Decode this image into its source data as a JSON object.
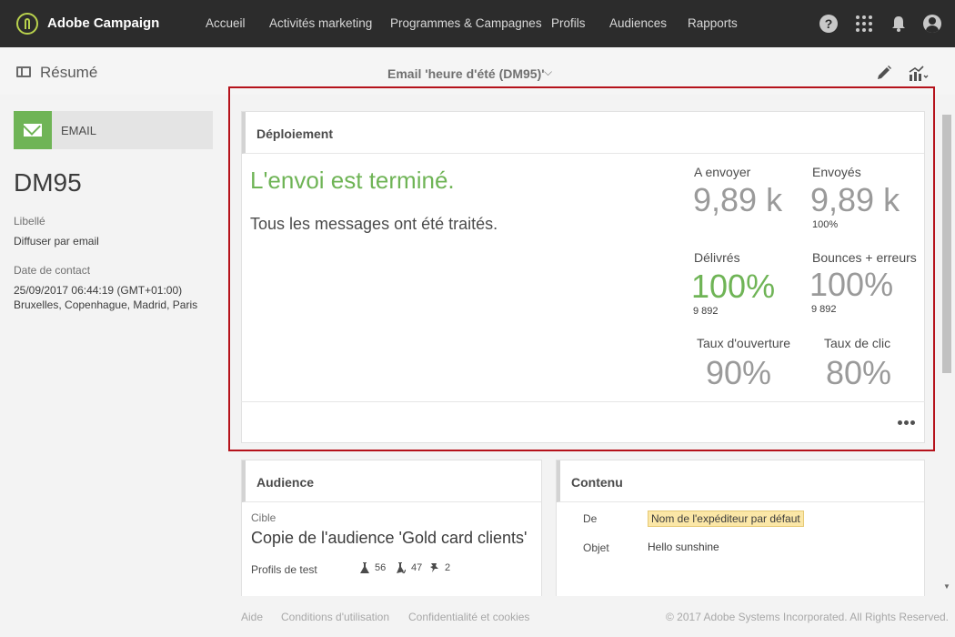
{
  "app": {
    "name": "Adobe Campaign"
  },
  "nav": {
    "items": [
      "Accueil",
      "Activités marketing",
      "Programmes & Campagnes",
      "Profils",
      "Audiences",
      "Rapports"
    ],
    "help": "?"
  },
  "subheader": {
    "title": "Résumé",
    "delivery_title": "Email 'heure d'été (DM95)'"
  },
  "left": {
    "channel": "EMAIL",
    "code": "DM95",
    "label_caption": "Libellé",
    "label_value": "Diffuser par email",
    "contact_caption": "Date de contact",
    "contact_date": "25/09/2017 06:44:19 (GMT+01:00)",
    "contact_tz": "Bruxelles, Copenhague, Madrid, Paris"
  },
  "deployment": {
    "title": "Déploiement",
    "status": "L'envoi est terminé.",
    "status_detail": "Tous les messages ont été traités.",
    "metrics": {
      "to_send": {
        "label": "A envoyer",
        "value": "9,89 k"
      },
      "sent": {
        "label": "Envoyés",
        "value": "9,89 k",
        "sub": "100%"
      },
      "delivered": {
        "label": "Délivrés",
        "value": "100%",
        "sub": "9 892"
      },
      "bounces": {
        "label": "Bounces + erreurs",
        "value": "100%",
        "sub": "9 892"
      },
      "open_rate": {
        "label": "Taux d'ouverture",
        "value": "90%"
      },
      "click_rate": {
        "label": "Taux de clic",
        "value": "80%"
      }
    }
  },
  "audience": {
    "title": "Audience",
    "target_caption": "Cible",
    "target_value": "Copie de l'audience 'Gold card clients'",
    "test_caption": "Profils de test",
    "counts": [
      "56",
      "47",
      "2"
    ]
  },
  "content": {
    "title": "Contenu",
    "from_caption": "De",
    "from_value": "Nom de l'expéditeur par défaut",
    "subject_caption": "Objet",
    "subject_value": "Hello sunshine"
  },
  "footer": {
    "links": [
      "Aide",
      "Conditions d'utilisation",
      "Confidentialité et cookies"
    ],
    "copyright": "© 2017 Adobe Systems Incorporated. All Rights Reserved."
  },
  "colors": {
    "nav_bg": "#2c2c2c",
    "success_green": "#6fb456",
    "highlight_red": "#b5121b",
    "sender_tag": "#fbe7a7"
  }
}
